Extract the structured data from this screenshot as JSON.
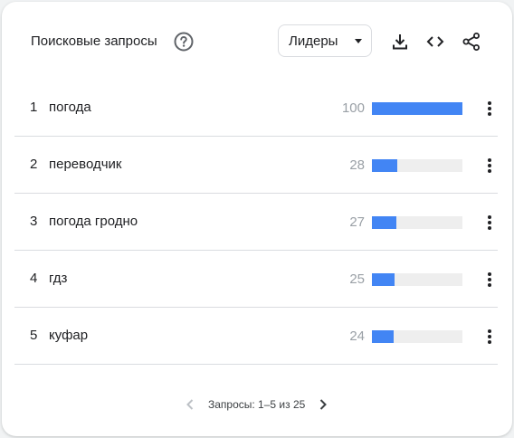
{
  "header": {
    "title": "Поисковые запросы",
    "help_icon": "help-circle-icon",
    "dropdown": {
      "selected": "Лидеры"
    },
    "tools": [
      "download-icon",
      "embed-code-icon",
      "share-icon"
    ]
  },
  "rows": [
    {
      "rank": "1",
      "term": "погода",
      "value": "100",
      "level": 100
    },
    {
      "rank": "2",
      "term": "переводчик",
      "value": "28",
      "level": 28
    },
    {
      "rank": "3",
      "term": "погода гродно",
      "value": "27",
      "level": 27
    },
    {
      "rank": "4",
      "term": "гдз",
      "value": "25",
      "level": 25
    },
    {
      "rank": "5",
      "term": "куфар",
      "value": "24",
      "level": 24
    }
  ],
  "pagination": {
    "text": "Запросы: 1–5 из 25"
  },
  "colors": {
    "bar": "#4285f4",
    "track": "#eeeeee",
    "value_text": "#9aa0a6"
  }
}
